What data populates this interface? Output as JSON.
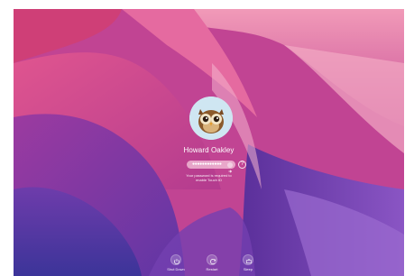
{
  "user": {
    "name": "Howard Oakley",
    "avatar_icon": "owl-avatar"
  },
  "password": {
    "masked_value": "●●●●●●●●●●●●",
    "help_icon_glyph": "?"
  },
  "touch_id_message": {
    "line1": "Your password is required to",
    "line2": "enable Touch ID"
  },
  "power_buttons": [
    {
      "label": "Shut Down",
      "icon": "power-icon"
    },
    {
      "label": "Restart",
      "icon": "restart-icon"
    },
    {
      "label": "Sleep",
      "icon": "sleep-icon"
    }
  ],
  "colors": {
    "wallpaper_pink": "#c73a86",
    "wallpaper_purple": "#5a3ea8",
    "avatar_bg": "#cfe6f2"
  }
}
